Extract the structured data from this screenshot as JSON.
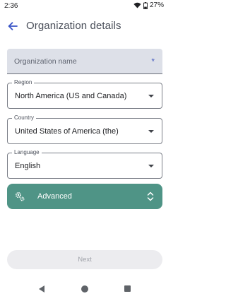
{
  "status_bar": {
    "time": "2:36",
    "battery_percent": "27%",
    "icons": [
      "wifi-icon",
      "battery-icon"
    ]
  },
  "app_bar": {
    "back_icon": "arrow-left-icon",
    "title": "Organization details"
  },
  "form": {
    "organization_name": {
      "placeholder": "Organization name",
      "value": "",
      "required_marker": "*"
    },
    "region": {
      "label": "Region",
      "value": "North America (US and Canada)"
    },
    "country": {
      "label": "Country",
      "value": "United States of America (the)"
    },
    "language": {
      "label": "Language",
      "value": "English"
    },
    "advanced": {
      "label": "Advanced",
      "icon": "gear-icon",
      "expand_icon": "unfold-icon",
      "color": "#4f9486"
    },
    "next_label": "Next"
  },
  "colors": {
    "accent": "#4f9486",
    "title_text": "#4a4f5a",
    "back_arrow": "#3a55c7"
  }
}
